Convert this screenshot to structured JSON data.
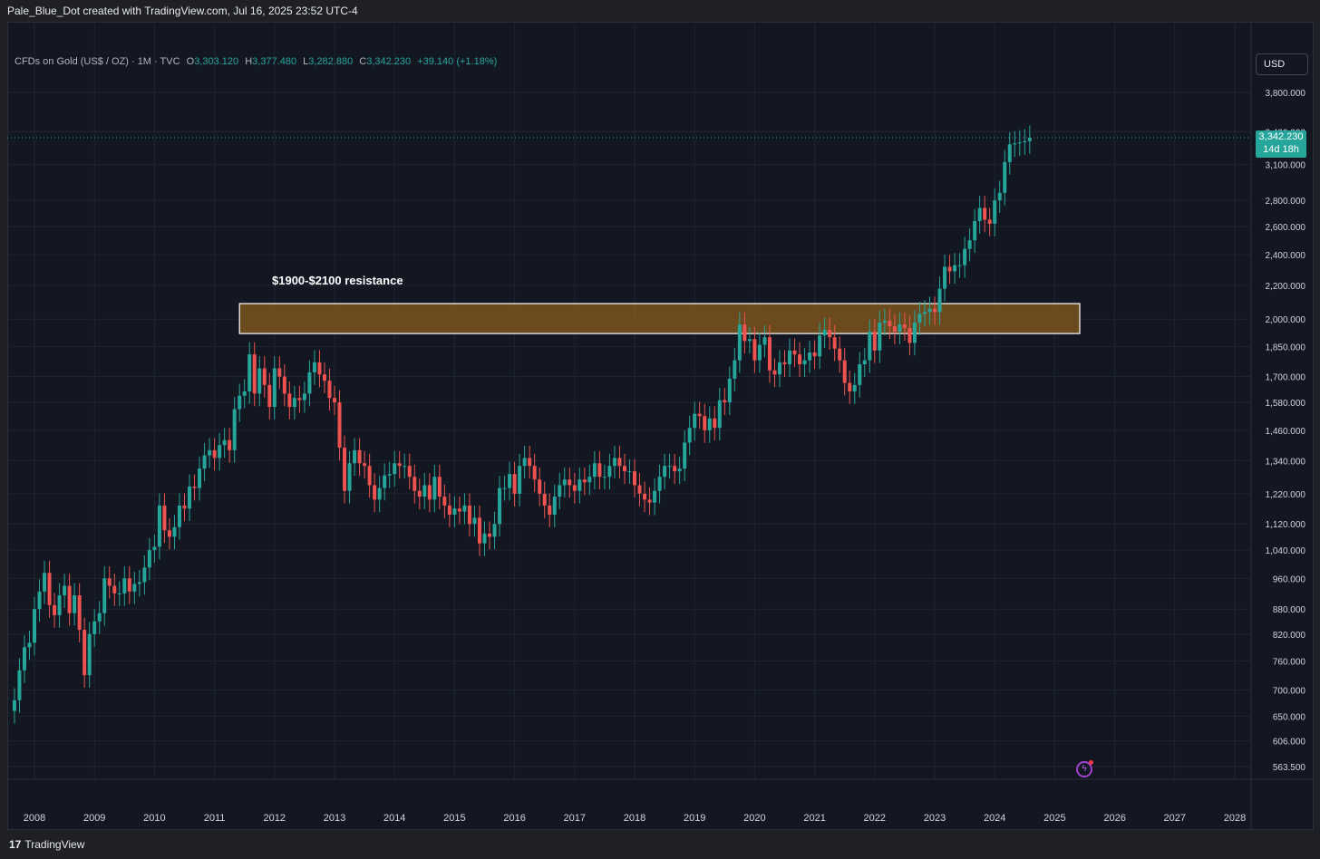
{
  "header": {
    "attribution": "Pale_Blue_Dot created with TradingView.com, Jul 16, 2025 23:52 UTC-4"
  },
  "legend": {
    "symbol": "CFDs on Gold (US$ / OZ) · 1M · TVC",
    "open_label": "O",
    "open": "3,303.120",
    "high_label": "H",
    "high": "3,377.480",
    "low_label": "L",
    "low": "3,282.880",
    "close_label": "C",
    "close": "3,342.230",
    "change": "+39.140 (+1.18%)"
  },
  "currency_button": "USD",
  "last_price": {
    "price": "3,342.230",
    "countdown": "14d 18h"
  },
  "annotation": "$1900-$2100 resistance",
  "footer": {
    "brand": "TradingView"
  },
  "colors": {
    "up": "#26a69a",
    "down": "#ef5350",
    "background": "#131722",
    "zone_fill": "#8a5d1c",
    "zone_border": "#ffffff"
  },
  "chart_data": {
    "type": "candlestick",
    "interval": "1M",
    "scale": "log",
    "grid": true,
    "y_tick_labels": [
      "3,800.000",
      "3,400.000",
      "3,100.000",
      "2,800.000",
      "2,600.000",
      "2,400.000",
      "2,200.000",
      "2,000.000",
      "1,850.000",
      "1,700.000",
      "1,580.000",
      "1,460.000",
      "1,340.000",
      "1,220.000",
      "1,120.000",
      "1,040.000",
      "960.000",
      "880.000",
      "820.000",
      "760.000",
      "700.000",
      "650.000",
      "606.000",
      "563.500"
    ],
    "x_tick_labels": [
      "2008",
      "2009",
      "2010",
      "2011",
      "2012",
      "2013",
      "2014",
      "2015",
      "2016",
      "2017",
      "2018",
      "2019",
      "2020",
      "2021",
      "2022",
      "2023",
      "2024",
      "2025",
      "2026",
      "2027",
      "2028"
    ],
    "resistance_zone": {
      "low": 1920,
      "high": 2090,
      "from": "2011-06",
      "to": "2025-06"
    },
    "start": "2007-09",
    "closes": [
      680,
      740,
      790,
      800,
      880,
      925,
      975,
      890,
      865,
      915,
      940,
      870,
      915,
      830,
      730,
      820,
      850,
      870,
      960,
      940,
      920,
      920,
      960,
      925,
      945,
      950,
      990,
      1040,
      1050,
      1180,
      1100,
      1080,
      1110,
      1180,
      1170,
      1245,
      1240,
      1310,
      1360,
      1380,
      1350,
      1400,
      1420,
      1380,
      1550,
      1610,
      1630,
      1810,
      1620,
      1740,
      1660,
      1560,
      1740,
      1700,
      1620,
      1560,
      1600,
      1590,
      1620,
      1720,
      1770,
      1710,
      1680,
      1600,
      1580,
      1390,
      1230,
      1330,
      1380,
      1330,
      1320,
      1250,
      1200,
      1240,
      1285,
      1290,
      1330,
      1320,
      1320,
      1280,
      1230,
      1210,
      1250,
      1200,
      1280,
      1210,
      1180,
      1150,
      1170,
      1160,
      1180,
      1120,
      1140,
      1060,
      1090,
      1080,
      1120,
      1240,
      1240,
      1290,
      1220,
      1320,
      1350,
      1320,
      1270,
      1220,
      1180,
      1150,
      1210,
      1250,
      1270,
      1250,
      1230,
      1270,
      1260,
      1280,
      1330,
      1280,
      1280,
      1320,
      1350,
      1320,
      1300,
      1300,
      1250,
      1220,
      1200,
      1190,
      1230,
      1280,
      1320,
      1320,
      1300,
      1310,
      1410,
      1470,
      1530,
      1520,
      1460,
      1510,
      1470,
      1590,
      1580,
      1690,
      1780,
      1970,
      1880,
      1890,
      1780,
      1860,
      1900,
      1730,
      1710,
      1770,
      1760,
      1830,
      1810,
      1760,
      1780,
      1820,
      1800,
      1910,
      1940,
      1900,
      1840,
      1780,
      1670,
      1630,
      1660,
      1760,
      1780,
      1930,
      1830,
      1980,
      1990,
      1960,
      1930,
      1970,
      1950,
      1870,
      1980,
      2030,
      2040,
      2060,
      2040,
      2180,
      2320,
      2290,
      2330,
      2330,
      2440,
      2500,
      2640,
      2740,
      2650,
      2620,
      2800,
      2860,
      3120,
      3280,
      3290,
      3300,
      3310,
      3342
    ]
  }
}
